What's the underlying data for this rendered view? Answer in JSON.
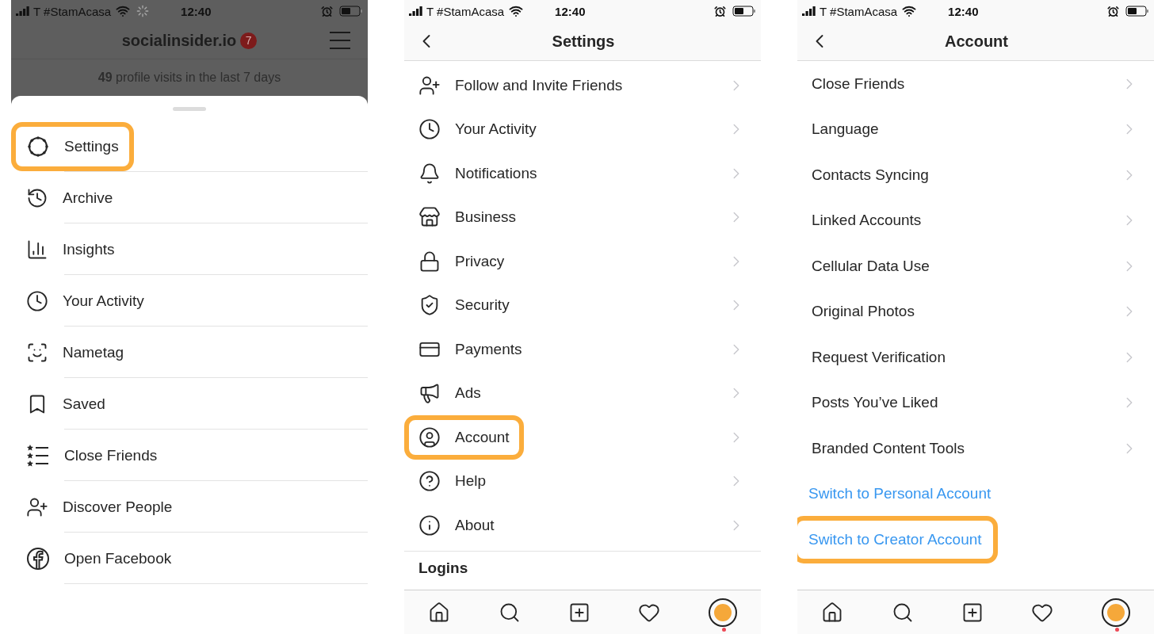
{
  "panels": [
    {
      "kind": "menu",
      "status_bar": {
        "carrier": "T #StamAcasa",
        "time": "12:40",
        "loading": true
      },
      "header": {
        "title": "socialinsider.io",
        "badge": "7"
      },
      "profile_visits": "**49** profile visits in the last 7 days",
      "items": [
        {
          "label": "Settings",
          "highlighted": true
        },
        {
          "label": "Archive",
          "highlighted": false
        },
        {
          "label": "Insights",
          "highlighted": false
        },
        {
          "label": "Your Activity",
          "highlighted": false
        },
        {
          "label": "Nametag",
          "highlighted": false
        },
        {
          "label": "Saved",
          "highlighted": false
        },
        {
          "label": "Close Friends",
          "highlighted": false
        },
        {
          "label": "Discover People",
          "highlighted": false
        },
        {
          "label": "Open Facebook",
          "highlighted": false
        }
      ]
    },
    {
      "kind": "settings",
      "status_bar": {
        "carrier": "T #StamAcasa",
        "time": "12:40",
        "loading": false
      },
      "title": "Settings",
      "items": [
        {
          "label": "Follow and Invite Friends",
          "highlighted": false
        },
        {
          "label": "Your Activity",
          "highlighted": false
        },
        {
          "label": "Notifications",
          "highlighted": false
        },
        {
          "label": "Business",
          "highlighted": false
        },
        {
          "label": "Privacy",
          "highlighted": false
        },
        {
          "label": "Security",
          "highlighted": false
        },
        {
          "label": "Payments",
          "highlighted": false
        },
        {
          "label": "Ads",
          "highlighted": false
        },
        {
          "label": "Account",
          "highlighted": true
        },
        {
          "label": "Help",
          "highlighted": false
        },
        {
          "label": "About",
          "highlighted": false
        }
      ],
      "section_heading": "Logins",
      "profile_notification": true
    },
    {
      "kind": "account",
      "status_bar": {
        "carrier": "T #StamAcasa",
        "time": "12:40",
        "loading": false
      },
      "title": "Account",
      "items": [
        {
          "label": "Close Friends",
          "highlighted": false
        },
        {
          "label": "Language",
          "highlighted": false
        },
        {
          "label": "Contacts Syncing",
          "highlighted": false
        },
        {
          "label": "Linked Accounts",
          "highlighted": false
        },
        {
          "label": "Cellular Data Use",
          "highlighted": false
        },
        {
          "label": "Original Photos",
          "highlighted": false
        },
        {
          "label": "Request Verification",
          "highlighted": false
        },
        {
          "label": "Posts You’ve Liked",
          "highlighted": false
        },
        {
          "label": "Branded Content Tools",
          "highlighted": false
        }
      ],
      "links": [
        {
          "label": "Switch to Personal Account",
          "highlighted": false
        },
        {
          "label": "Switch to Creator Account",
          "highlighted": true
        }
      ],
      "profile_notification": true
    }
  ]
}
